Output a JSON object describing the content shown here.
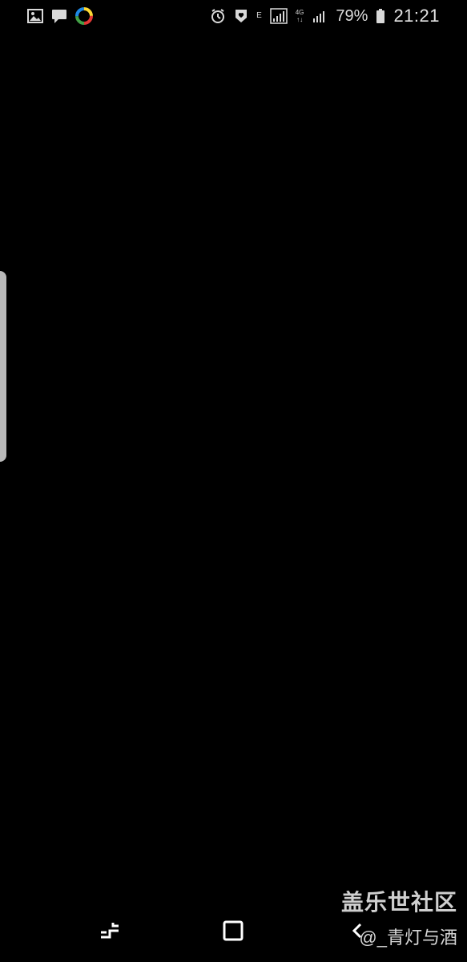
{
  "status_bar": {
    "left_icons": [
      "gallery-icon",
      "message-icon",
      "colorful-app-icon"
    ],
    "signal_letter": "E",
    "network": "4G",
    "battery": "79%",
    "time": "21:21"
  },
  "watermark": {
    "title": "盖乐世社区",
    "handle": "@_青灯与酒"
  },
  "navigation": {
    "recent_icon": "recent-apps-icon",
    "home_icon": "home-icon",
    "back_icon": "back-icon"
  }
}
